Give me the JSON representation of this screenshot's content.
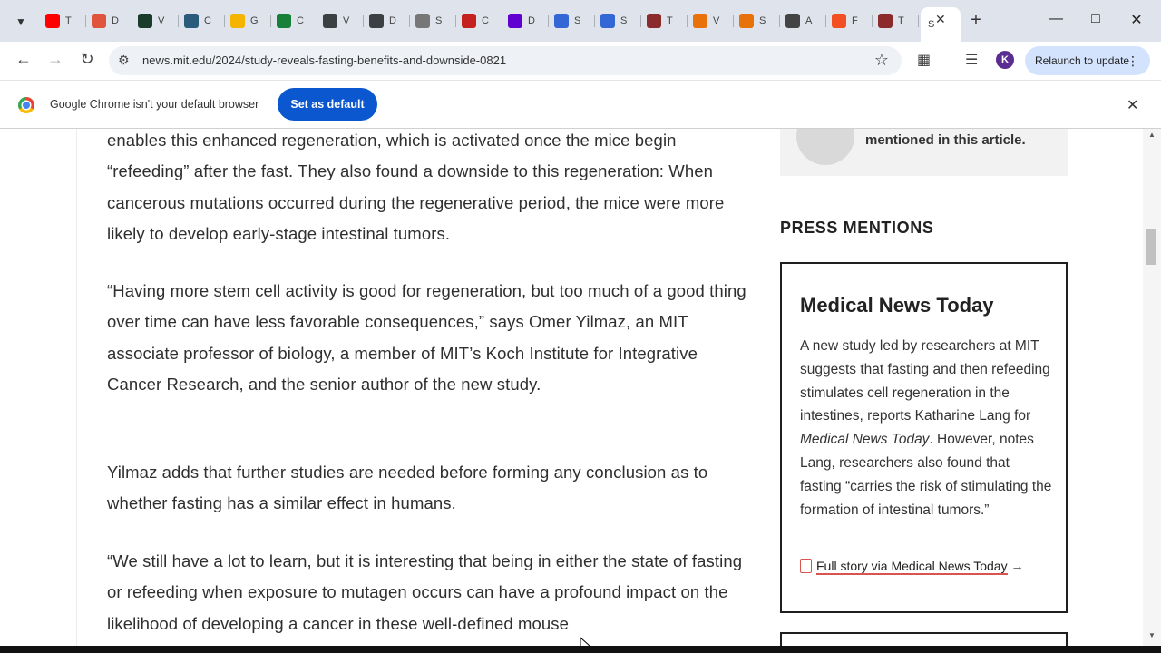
{
  "tabs": [
    {
      "letter": "T",
      "color": "#ff0000"
    },
    {
      "letter": "D",
      "color": "#e0533c"
    },
    {
      "letter": "V",
      "color": "#1a3d2b"
    },
    {
      "letter": "C",
      "color": "#2b5b7a"
    },
    {
      "letter": "G",
      "color": "#f4b400"
    },
    {
      "letter": "C",
      "color": "#188038"
    },
    {
      "letter": "V",
      "color": "#3c4043"
    },
    {
      "letter": "D",
      "color": "#3c4043"
    },
    {
      "letter": "S",
      "color": "#777777"
    },
    {
      "letter": "C",
      "color": "#c5221f"
    },
    {
      "letter": "D",
      "color": "#6001d2"
    },
    {
      "letter": "S",
      "color": "#3367d6"
    },
    {
      "letter": "S",
      "color": "#3367d6"
    },
    {
      "letter": "T",
      "color": "#8c2b2b"
    },
    {
      "letter": "V",
      "color": "#e8710a"
    },
    {
      "letter": "S",
      "color": "#e8710a"
    },
    {
      "letter": "A",
      "color": "#444444"
    },
    {
      "letter": "F",
      "color": "#f25022"
    },
    {
      "letter": "T",
      "color": "#8c2b2b"
    }
  ],
  "active_tab": {
    "letter": "S"
  },
  "toolbar": {
    "url": "news.mit.edu/2024/study-reveals-fasting-benefits-and-downside-0821",
    "relaunch_label": "Relaunch to update",
    "profile_letter": "K"
  },
  "infobar": {
    "message": "Google Chrome isn't your default browser",
    "button_label": "Set as default"
  },
  "article": {
    "paragraphs": [
      "enables this enhanced regeneration, which is activated once the mice begin “refeeding” after the fast. They also found a downside to this regeneration: When cancerous mutations occurred during the regenerative period, the mice were more likely to develop early-stage intestinal tumors.",
      "“Having more stem cell activity is good for regeneration, but too much of a good thing over time can have less favorable consequences,” says Omer Yilmaz, an MIT associate professor of biology, a member of MIT’s Koch Institute for Integrative Cancer Research, and the senior author of the new study.",
      "Yilmaz adds that further studies are needed before forming any conclusion as to whether fasting has a similar effect in humans.",
      "“We still have a lot to learn, but it is interesting that being in either the state of fasting or refeeding when exposure to mutagen occurs can have a profound impact on the likelihood of developing a cancer in these well-defined mouse"
    ]
  },
  "sidebar": {
    "author_card_text": "mentioned in this article.",
    "press_mentions_title": "PRESS MENTIONS",
    "press": {
      "outlet": "Medical News Today",
      "body_part1": "A new study led by researchers at MIT suggests that fasting and then refeeding stimulates cell regeneration in the intestines, reports Katharine Lang for ",
      "body_italic": "Medical News Today",
      "body_part2": ". However, notes Lang, researchers also found that fasting “carries the risk of stimulating the formation of intestinal tumors.”",
      "link_label": "Full story via Medical News Today",
      "link_arrow": "→"
    }
  }
}
